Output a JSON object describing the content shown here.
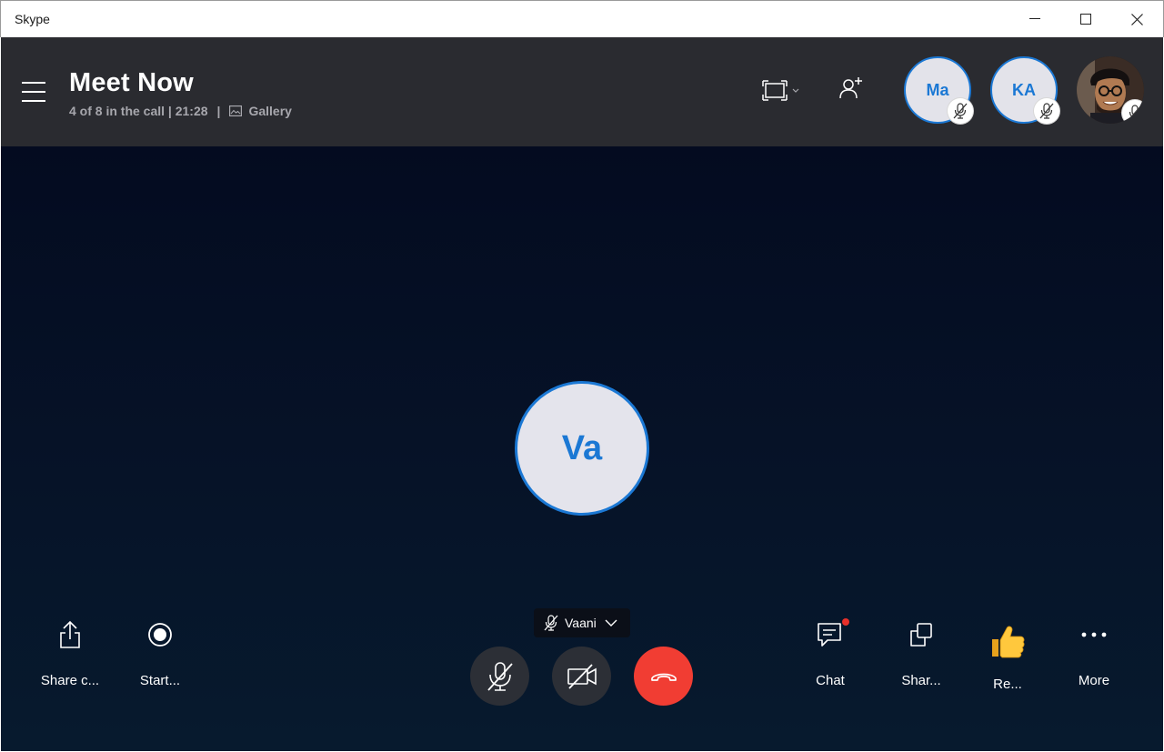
{
  "window": {
    "title": "Skype",
    "controls": [
      "minimize",
      "maximize",
      "close"
    ]
  },
  "header": {
    "title": "Meet Now",
    "participants_text": "4 of 8 in the call | 21:28",
    "separator": "|",
    "view_label": "Gallery"
  },
  "participants": [
    {
      "initials": "Ma",
      "muted": true
    },
    {
      "initials": "KA",
      "muted": true
    },
    {
      "photo": true,
      "muted": true
    }
  ],
  "main": {
    "speaker_initials": "Va"
  },
  "toolbar": {
    "share_content": "Share c...",
    "start_recording": "Start...",
    "mic_device": "Vaani",
    "chat": "Chat",
    "share_screen": "Shar...",
    "react": "Re...",
    "more": "More"
  },
  "colors": {
    "header_bg": "#2a2b30",
    "stage_bg": "#061328",
    "accent": "#1b78d4",
    "end_call": "#f13d33"
  }
}
